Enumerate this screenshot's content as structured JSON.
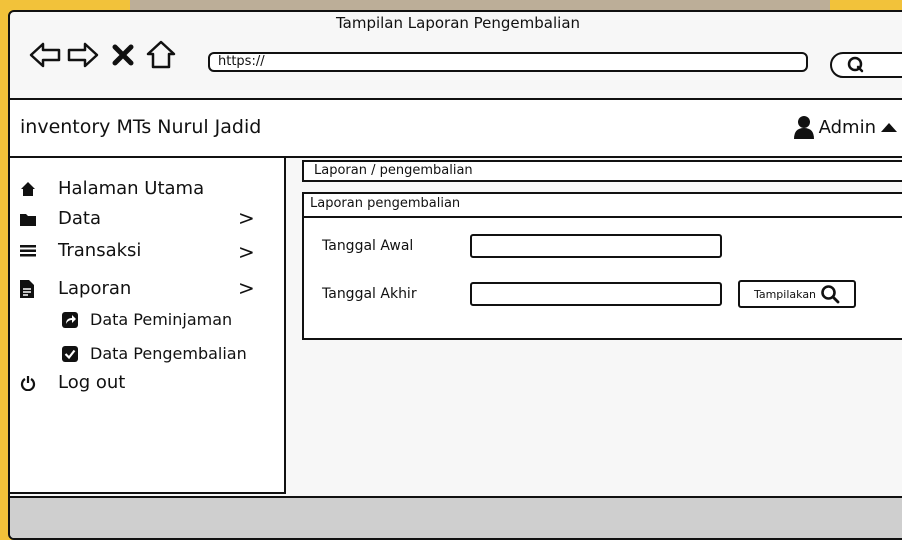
{
  "window": {
    "title": "Tampilan Laporan Pengembalian"
  },
  "browser": {
    "url": "https://",
    "icons": [
      "arrow-left-icon",
      "arrow-right-icon",
      "close-icon",
      "home-icon",
      "search-icon"
    ]
  },
  "app": {
    "title": "inventory MTs Nurul Jadid",
    "user": "Admin"
  },
  "sidebar": {
    "items": [
      {
        "label": "Halaman Utama",
        "icon": "home-icon"
      },
      {
        "label": "Data",
        "icon": "folder-icon",
        "has_chevron": true
      },
      {
        "label": "Transaksi",
        "icon": "list-icon",
        "has_chevron": true
      },
      {
        "label": "Laporan",
        "icon": "document-icon",
        "has_chevron": true
      },
      {
        "label": "Log out",
        "icon": "power-icon"
      }
    ],
    "subitems": [
      {
        "label": "Data Peminjaman",
        "icon": "share-icon"
      },
      {
        "label": "Data Pengembalian",
        "icon": "checkbox-checked-icon"
      }
    ]
  },
  "breadcrumb": "Laporan / pengembalian",
  "panel": {
    "title": "Laporan pengembalian",
    "start_label": "Tanggal Awal",
    "end_label": "Tanggal Akhir",
    "button_label": "Tampilakan"
  },
  "colors": {
    "background": "#f2c23a",
    "window": "#f7f7f7",
    "footer": "#cfcfcf"
  }
}
